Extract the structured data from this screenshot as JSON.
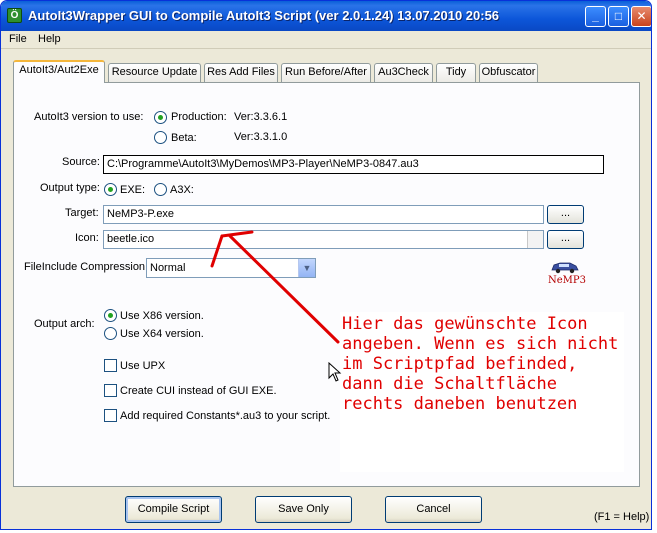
{
  "window": {
    "title": "AutoIt3Wrapper GUI to Compile AutoIt3 Script (ver 2.0.1.24) 13.07.2010 20:56",
    "app_icon_glyph": "Ö",
    "min_glyph": "_",
    "max_glyph": "□",
    "close_glyph": "✕"
  },
  "menu": {
    "file": "File",
    "help": "Help"
  },
  "tabs": [
    {
      "label": "AutoIt3/Aut2Exe"
    },
    {
      "label": "Resource Update"
    },
    {
      "label": "Res Add Files"
    },
    {
      "label": "Run Before/After"
    },
    {
      "label": "Au3Check"
    },
    {
      "label": "Tidy"
    },
    {
      "label": "Obfuscator"
    }
  ],
  "form": {
    "version_label": "AutoIt3 version to use:",
    "production_label": "Production:",
    "production_ver": "Ver:3.3.6.1",
    "beta_label": "Beta:",
    "beta_ver": "Ver:3.3.1.0",
    "source_label": "Source:",
    "source_value": "C:\\Programme\\AutoIt3\\MyDemos\\MP3-Player\\NeMP3-0847.au3",
    "output_type_label": "Output type:",
    "exe_label": "EXE:",
    "a3x_label": "A3X:",
    "target_label": "Target:",
    "target_value": "NeMP3-P.exe",
    "icon_label": "Icon:",
    "icon_value": "beetle.ico",
    "browse_label": "...",
    "compression_label": "FileInclude Compression:",
    "compression_value": "Normal",
    "arch_label": "Output arch:",
    "x86_label": "Use X86 version.",
    "x64_label": "Use X64 version.",
    "upx_label": "Use UPX",
    "cui_label": "Create CUI instead of GUI EXE.",
    "constants_label": "Add required Constants*.au3 to your script.",
    "logo_text": "NeMP3"
  },
  "buttons": {
    "compile": "Compile Script",
    "save": "Save Only",
    "cancel": "Cancel",
    "f1": "(F1 = Help)"
  },
  "annotation": {
    "text": "Hier das gewünschte Icon angeben. Wenn es sich nicht im Scriptpfad befinded, dann die Schaltfläche rechts daneben benutzen",
    "color": "#e00000"
  },
  "colors": {
    "titlebar": "#0a5fd8",
    "accent_tab": "#f4b63b",
    "annotation": "#e00000"
  }
}
